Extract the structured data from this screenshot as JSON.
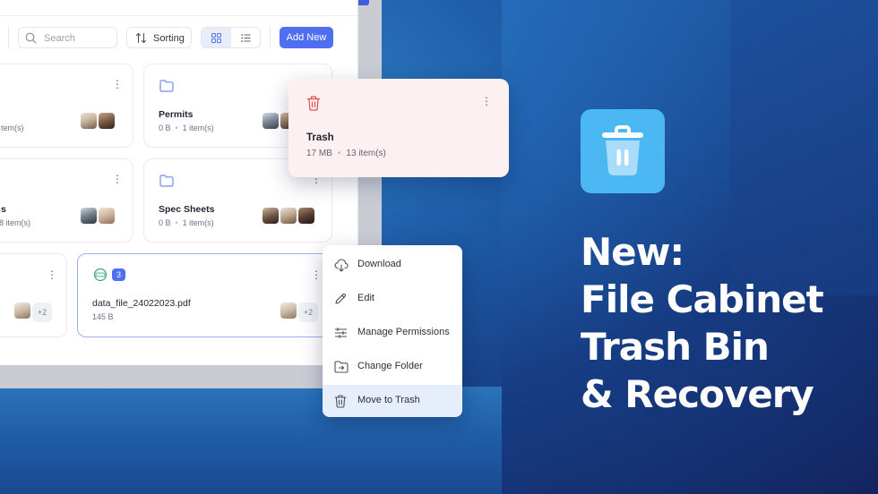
{
  "toolbar": {
    "search_placeholder": "Search",
    "sorting_label": "Sorting",
    "add_new_label": "Add New"
  },
  "cards": [
    {
      "id": "left-1",
      "name": "",
      "meta_size": "",
      "meta_items": "tem(s)"
    },
    {
      "id": "permits",
      "name": "Permits",
      "meta_size": "0 B",
      "meta_items": "1 item(s)"
    },
    {
      "id": "left-2",
      "name": "s",
      "meta_size": "",
      "meta_items": "8 item(s)"
    },
    {
      "id": "spec-sheets",
      "name": "Spec Sheets",
      "meta_size": "0 B",
      "meta_items": "1 item(s)"
    },
    {
      "id": "left-3",
      "name": "",
      "meta_size": "",
      "meta_items": "",
      "extra": "+2"
    },
    {
      "id": "data-file",
      "name": "data_file_24022023.pdf",
      "meta_size": "145 B",
      "meta_items": "",
      "badge": "3",
      "extra": "+2"
    }
  ],
  "trash_card": {
    "title": "Trash",
    "size": "17 MB",
    "items": "13 item(s)"
  },
  "context_menu": [
    {
      "label": "Download",
      "icon": "cloud-download-icon"
    },
    {
      "label": "Edit",
      "icon": "pencil-icon"
    },
    {
      "label": "Manage Permissions",
      "icon": "sliders-icon"
    },
    {
      "label": "Change Folder",
      "icon": "folder-move-icon"
    },
    {
      "label": "Move to Trash",
      "icon": "trash-icon"
    }
  ],
  "promo": {
    "icon": "trash-icon",
    "headline_lines": [
      "New:",
      "File Cabinet",
      "Trash Bin",
      "& Recovery"
    ]
  },
  "colors": {
    "accent": "#4f6ef2",
    "promo_icon_bg": "#4cb8f3",
    "trash_card_bg": "#fdf0f1",
    "trash_red": "#e5484d"
  }
}
